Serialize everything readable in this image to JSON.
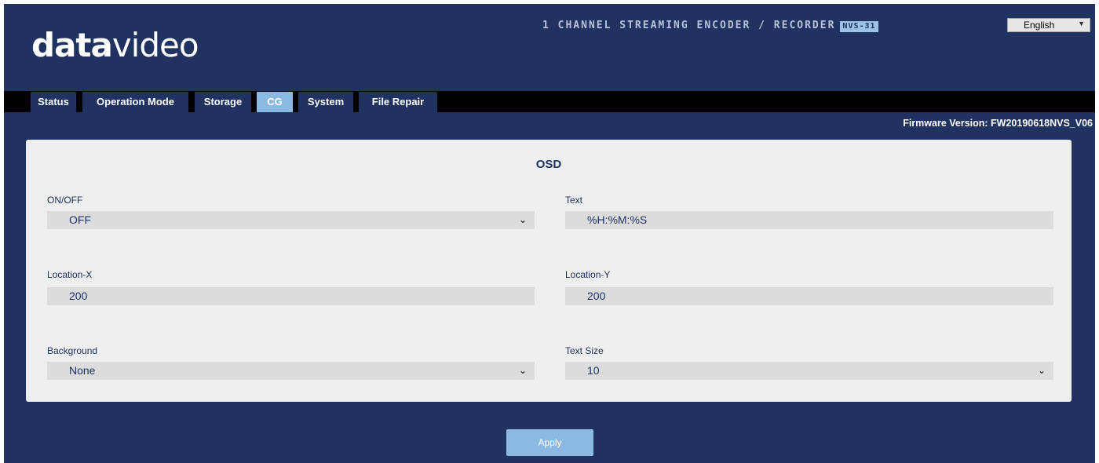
{
  "header": {
    "logo_bold": "data",
    "logo_thin": "video",
    "product_title": "1 CHANNEL STREAMING ENCODER / RECORDER",
    "model": "NVS-31",
    "language": "English"
  },
  "nav": {
    "tabs": [
      {
        "label": "Status",
        "active": false
      },
      {
        "label": "Operation Mode",
        "active": false
      },
      {
        "label": "Storage",
        "active": false
      },
      {
        "label": "CG",
        "active": true
      },
      {
        "label": "System",
        "active": false
      },
      {
        "label": "File Repair",
        "active": false
      }
    ]
  },
  "firmware": "Firmware Version: FW20190618NVS_V06",
  "osd": {
    "title": "OSD",
    "onoff": {
      "label": "ON/OFF",
      "value": "OFF"
    },
    "text": {
      "label": "Text",
      "value": "%H:%M:%S"
    },
    "location_x": {
      "label": "Location-X",
      "value": "200"
    },
    "location_y": {
      "label": "Location-Y",
      "value": "200"
    },
    "background": {
      "label": "Background",
      "value": "None"
    },
    "text_size": {
      "label": "Text Size",
      "value": "10"
    }
  },
  "apply_label": "Apply",
  "colors": {
    "background": "#1f3260",
    "nav_bar": "#000000",
    "active_tab": "#8cb9e4",
    "panel": "#efefef",
    "field": "#dcdcdc"
  }
}
